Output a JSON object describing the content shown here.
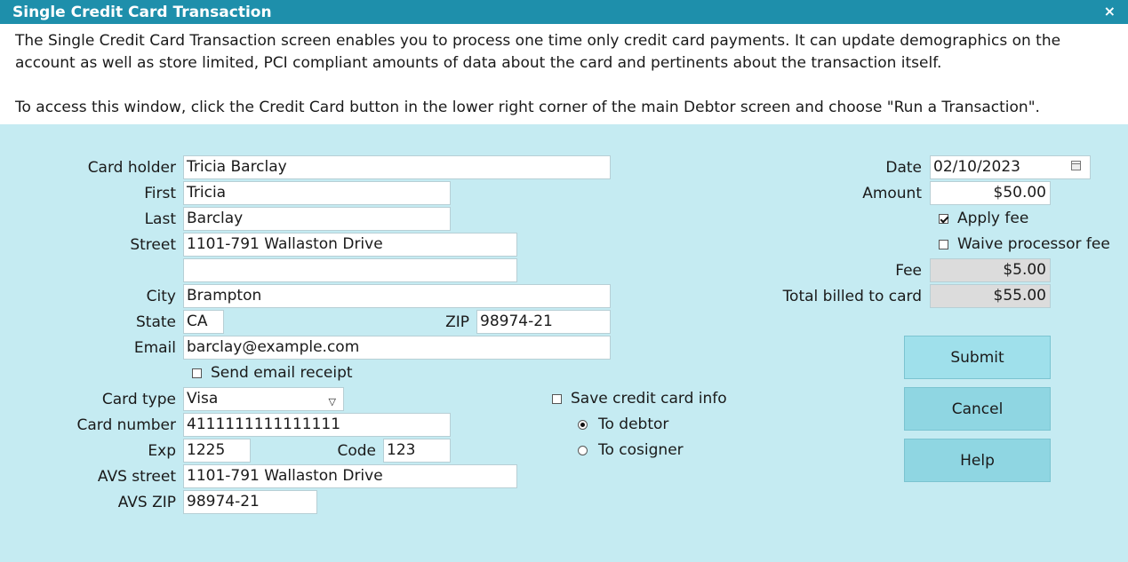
{
  "window": {
    "title": "Single Credit Card Transaction",
    "close_glyph": "×"
  },
  "description": {
    "paragraph1": "The Single Credit Card Transaction screen enables you to process one time only credit card payments. It can update demographics on the account as well as store limited, PCI compliant amounts of data about the card and pertinents about the transaction itself.",
    "paragraph2": "To access this window, click the Credit Card button in the lower right corner of the main Debtor screen and choose \"Run a Transaction\"."
  },
  "form": {
    "card_holder": {
      "label": "Card holder",
      "value": "Tricia Barclay"
    },
    "first": {
      "label": "First",
      "value": "Tricia"
    },
    "last": {
      "label": "Last",
      "value": "Barclay"
    },
    "street": {
      "label": "Street",
      "value": "1101-791 Wallaston Drive",
      "value2": ""
    },
    "city": {
      "label": "City",
      "value": "Brampton"
    },
    "state": {
      "label": "State",
      "value": "CA"
    },
    "zip": {
      "label": "ZIP",
      "value": "98974-21"
    },
    "email": {
      "label": "Email",
      "value": "barclay@example.com"
    },
    "send_receipt": {
      "label": "Send email receipt",
      "checked": false
    },
    "card_type": {
      "label": "Card type",
      "value": "Visa"
    },
    "card_number": {
      "label": "Card number",
      "value": "4111111111111111"
    },
    "exp": {
      "label": "Exp",
      "value": "1225"
    },
    "code": {
      "label": "Code",
      "value": "123"
    },
    "avs_street": {
      "label": "AVS street",
      "value": "1101-791 Wallaston Drive"
    },
    "avs_zip": {
      "label": "AVS ZIP",
      "value": "98974-21"
    },
    "save_card": {
      "label": "Save credit card info",
      "checked": false
    },
    "to_debtor": {
      "label": "To debtor",
      "selected": true
    },
    "to_cosigner": {
      "label": "To cosigner",
      "selected": false
    }
  },
  "summary": {
    "date": {
      "label": "Date",
      "value": "02/10/2023"
    },
    "amount": {
      "label": "Amount",
      "value": "$50.00"
    },
    "apply_fee": {
      "label": "Apply fee",
      "checked": true
    },
    "waive_fee": {
      "label": "Waive processor fee",
      "checked": false
    },
    "fee": {
      "label": "Fee",
      "value": "$5.00"
    },
    "total": {
      "label": "Total billed to card",
      "value": "$55.00"
    }
  },
  "buttons": {
    "submit": "Submit",
    "cancel": "Cancel",
    "help": "Help"
  },
  "colors": {
    "titlebar": "#1e8fab",
    "background": "#c5ebf2",
    "button": "#8fd6e2"
  }
}
